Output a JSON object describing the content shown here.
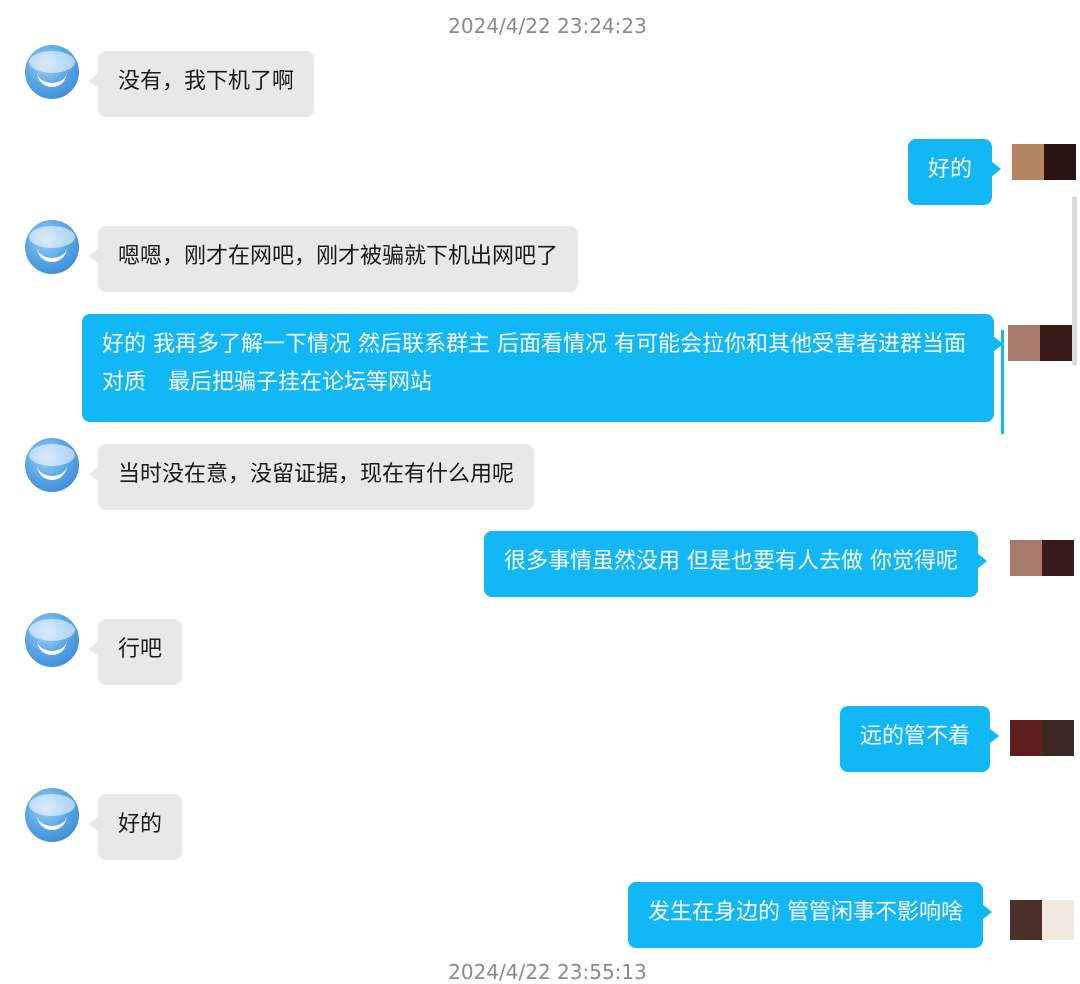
{
  "timestamps": {
    "top": "2024/4/22 23:24:23",
    "bottom": "2024/4/22 23:55:13"
  },
  "messages": [
    {
      "direction": "incoming",
      "text": "没有，我下机了啊"
    },
    {
      "direction": "outgoing",
      "text": "好的"
    },
    {
      "direction": "incoming",
      "text": "嗯嗯，刚才在网吧，刚才被骗就下机出网吧了"
    },
    {
      "direction": "outgoing",
      "text": "好的 我再多了解一下情况 然后联系群主 后面看情况 有可能会拉你和其他受害者进群当面对质　最后把骗子挂在论坛等网站"
    },
    {
      "direction": "incoming",
      "text": "当时没在意，没留证据，现在有什么用呢"
    },
    {
      "direction": "outgoing",
      "text": "很多事情虽然没用 但是也要有人去做 你觉得呢"
    },
    {
      "direction": "incoming",
      "text": "行吧"
    },
    {
      "direction": "outgoing",
      "text": "远的管不着"
    },
    {
      "direction": "incoming",
      "text": "好的"
    },
    {
      "direction": "outgoing",
      "text": "发生在身边的 管管闲事不影响啥"
    }
  ],
  "colors": {
    "incoming_bubble": "#e8e8e8",
    "outgoing_bubble": "#12b7f5",
    "timestamp_text": "#8a8a8a"
  },
  "icons": {
    "incoming_avatar": "blue-smile-avatar-icon",
    "outgoing_avatar": "pixelated-avatar-icon"
  }
}
